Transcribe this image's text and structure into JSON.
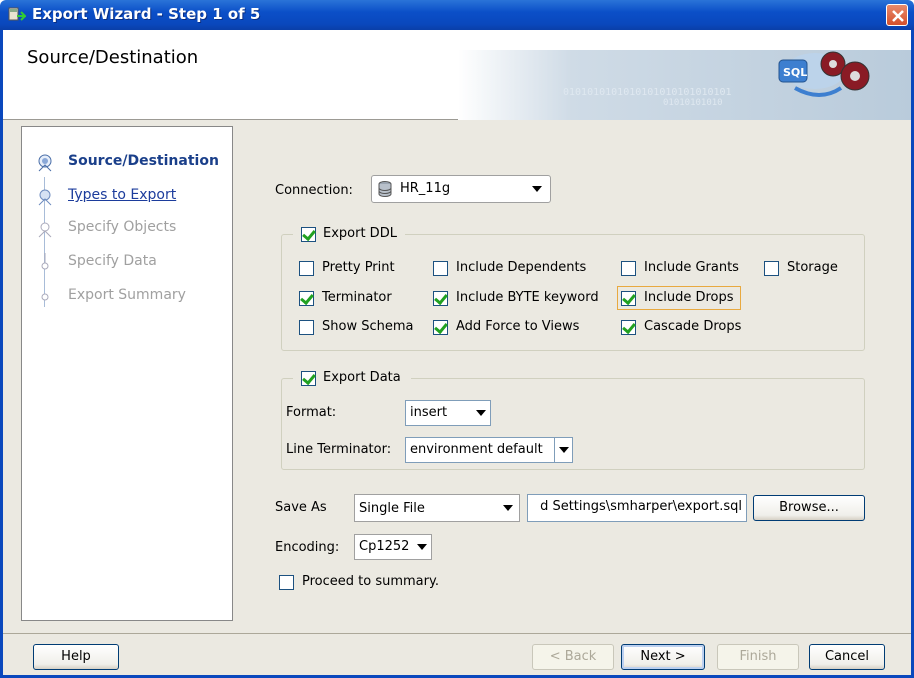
{
  "window": {
    "title": "Export Wizard - Step 1 of 5",
    "close_label": "close"
  },
  "header": {
    "title": "Source/Destination",
    "binary_text_1": "0101010101010101010101010101",
    "binary_text_2": "01010101010"
  },
  "steps": [
    {
      "label": "Source/Destination",
      "state": "active"
    },
    {
      "label": "Types to Export",
      "state": "link"
    },
    {
      "label": "Specify Objects",
      "state": "disabled"
    },
    {
      "label": "Specify Data",
      "state": "disabled"
    },
    {
      "label": "Export Summary",
      "state": "disabled"
    }
  ],
  "connection": {
    "label": "Connection:",
    "value": "HR_11g"
  },
  "export_ddl": {
    "label": "Export DDL",
    "checked": true,
    "options": [
      {
        "label": "Pretty Print",
        "checked": false
      },
      {
        "label": "Include Dependents",
        "checked": false
      },
      {
        "label": "Include Grants",
        "checked": false
      },
      {
        "label": "Storage",
        "checked": false
      },
      {
        "label": "Terminator",
        "checked": true
      },
      {
        "label": "Include BYTE keyword",
        "checked": true
      },
      {
        "label": "Include Drops",
        "checked": true
      },
      {
        "label": "Show Schema",
        "checked": false
      },
      {
        "label": "Add Force to Views",
        "checked": true
      },
      {
        "label": "Cascade Drops",
        "checked": true
      }
    ]
  },
  "export_data": {
    "label": "Export Data",
    "checked": true,
    "format_label": "Format:",
    "format_value": "insert",
    "terminator_label": "Line Terminator:",
    "terminator_value": "environment default"
  },
  "save_as": {
    "label": "Save As",
    "value": "Single File",
    "path": "d Settings\\smharper\\export.sql",
    "browse_label": "Browse..."
  },
  "encoding": {
    "label": "Encoding:",
    "value": "Cp1252"
  },
  "proceed": {
    "label": "Proceed to summary.",
    "checked": false
  },
  "buttons": {
    "help": "Help",
    "back": "< Back",
    "next": "Next >",
    "finish": "Finish",
    "cancel": "Cancel"
  }
}
